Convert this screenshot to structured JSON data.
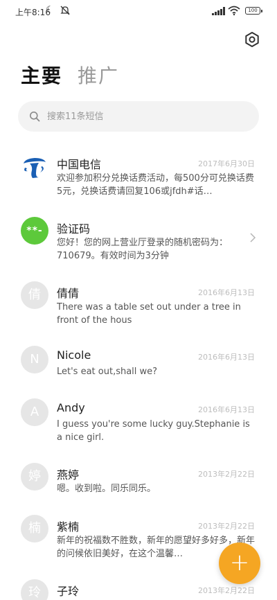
{
  "status_bar": {
    "time": "上午8:16",
    "battery": "100",
    "icons": [
      "moon-icon",
      "mute-icon",
      "signal-icon",
      "wifi-icon",
      "battery-icon"
    ]
  },
  "header": {
    "title": "主要",
    "subtitle": "推广",
    "settings_icon": "settings-icon"
  },
  "search": {
    "placeholder": "搜索11条短信",
    "icon": "search-icon"
  },
  "messages": [
    {
      "avatar_type": "logo",
      "avatar_text": "",
      "name": "中国电信",
      "date": "2017年6月30日",
      "preview": "欢迎参加积分兑换话费活动，每500分可兑换话费5元，兑换话费请回复106或jfdh#话…"
    },
    {
      "avatar_type": "green",
      "avatar_text": "**-",
      "name": "验证码",
      "date": "",
      "preview": "您好！您的网上营业厅登录的随机密码为：710679。有效时间为3分钟",
      "has_chevron": true
    },
    {
      "avatar_type": "letter",
      "avatar_text": "倩",
      "name": "倩倩",
      "date": "2016年6月13日",
      "preview": "There was a table set out under a tree in front of the hous"
    },
    {
      "avatar_type": "letter",
      "avatar_text": "N",
      "name": "Nicole",
      "date": "2016年6月13日",
      "preview": "Let's eat out,shall we?"
    },
    {
      "avatar_type": "letter",
      "avatar_text": "A",
      "name": "Andy",
      "date": "2016年6月13日",
      "preview": "I guess you're some lucky guy.Stephanie is a nice girl."
    },
    {
      "avatar_type": "letter",
      "avatar_text": "婷",
      "name": "燕婷",
      "date": "2013年2月22日",
      "preview": "嗯。收到啦。同乐同乐。"
    },
    {
      "avatar_type": "letter",
      "avatar_text": "楠",
      "name": "紫楠",
      "date": "2013年2月22日",
      "preview": "新年的祝福数不胜数，新年的愿望好多好多，新年的问候依旧美好，在这个温馨…"
    },
    {
      "avatar_type": "letter",
      "avatar_text": "玲",
      "name": "子玲",
      "date": "2013年2月22日",
      "preview": ""
    }
  ],
  "fab": {
    "label": "+",
    "icon": "plus-icon",
    "color": "#f5a623"
  },
  "colors": {
    "accent": "#f5a623",
    "green_avatar": "#5dc93b",
    "telecom_blue": "#1a5fb4"
  }
}
